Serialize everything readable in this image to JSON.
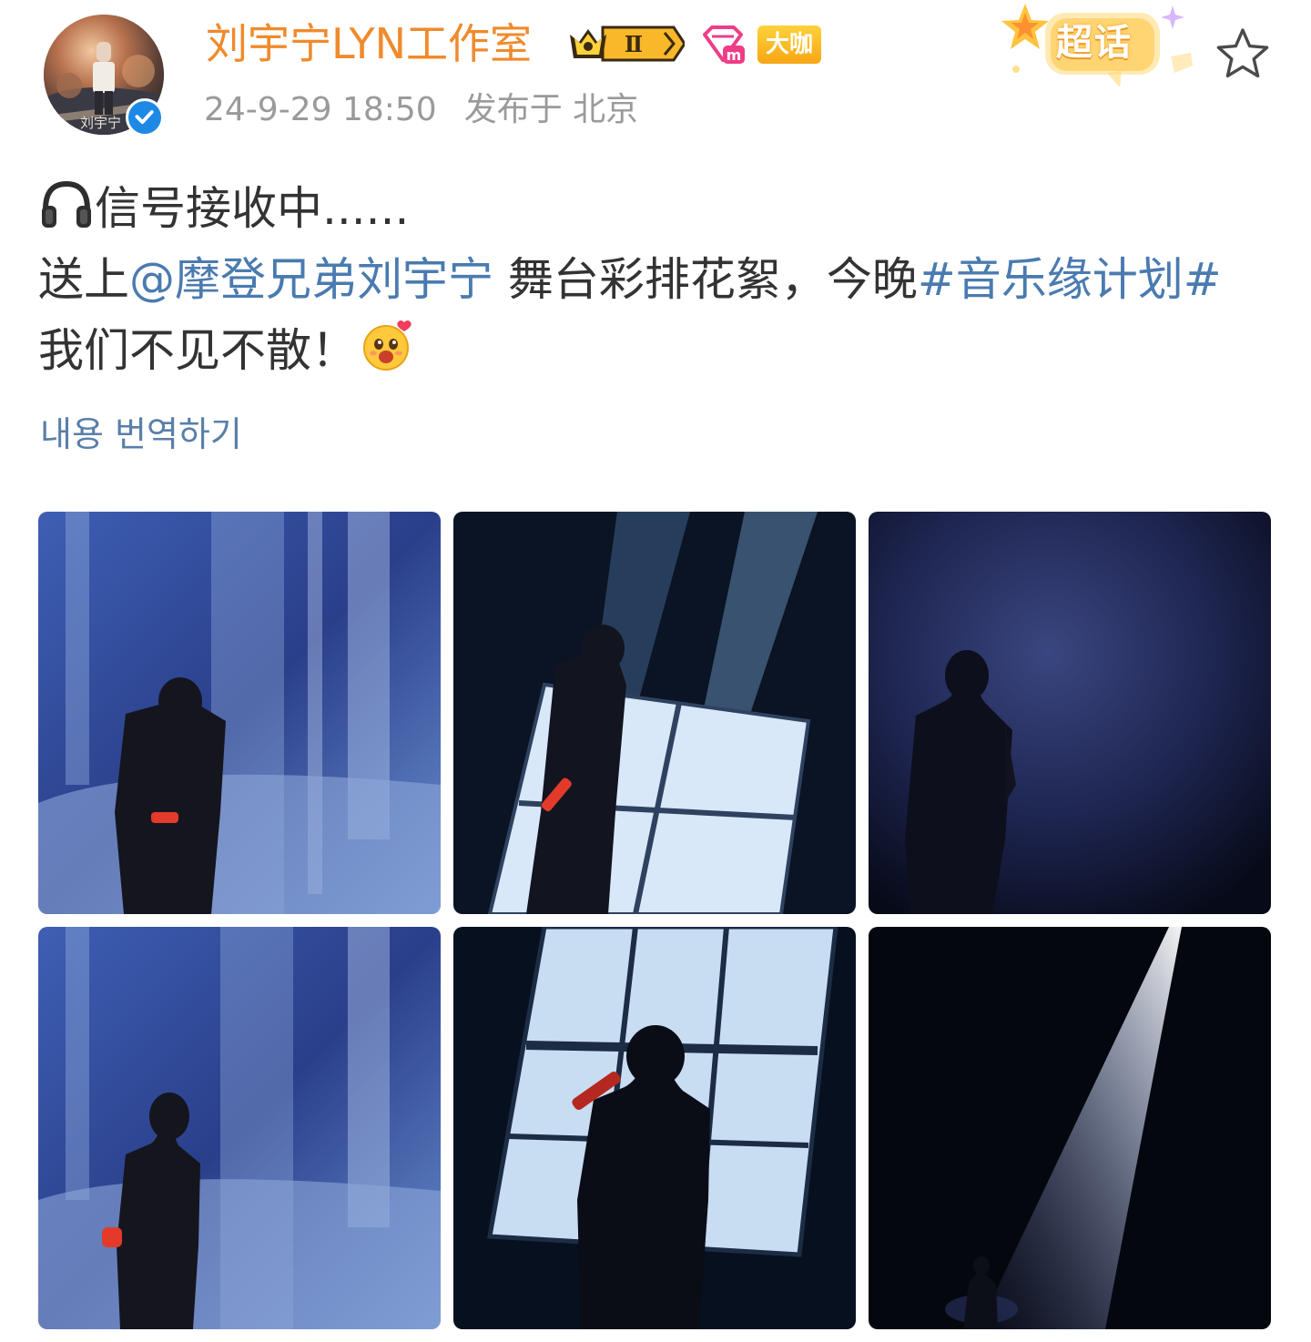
{
  "post": {
    "author": {
      "name": "刘宇宁LYN工作室",
      "avatar_caption": "刘宇宁",
      "badges": {
        "crown_level": "Ⅱ",
        "vip_label": "m",
        "daka_label": "大咖"
      }
    },
    "meta": {
      "date": "24-9-29 18:50",
      "location": "发布于 北京"
    },
    "super_topic_label": "超话",
    "text": {
      "line1": "信号接收中......",
      "line2_prefix": "送上",
      "mention": "@摩登兄弟刘宇宁",
      "line2_middle": " 舞台彩排花絮，今晚",
      "hashtag": "#音乐缘计划#",
      "line3": "我们不见不散！"
    },
    "translate_label": "내용 번역하기",
    "photo_count": 6,
    "icons": {
      "star": "star-outline-icon",
      "headphone": "headphone-icon",
      "emoji": "love-emoji-icon",
      "verified": "verified-check-icon"
    },
    "colors": {
      "username": "#f08a2c",
      "link": "#4a7bb0",
      "meta": "#9a9a9a",
      "translate": "#5a7fa8",
      "verified": "#1e88e5"
    }
  }
}
